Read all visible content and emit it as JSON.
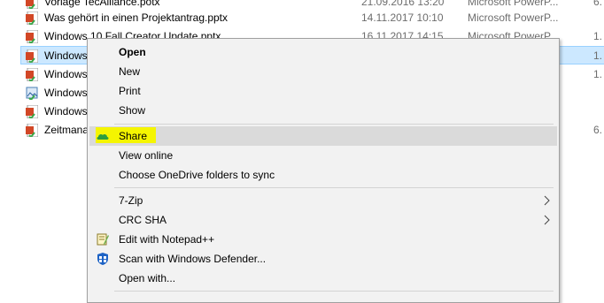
{
  "files": [
    {
      "name": "Vorlage TecAlliance.potx",
      "date": "21.09.2016 13:20",
      "type": "Microsoft PowerP...",
      "size": "6."
    },
    {
      "name": "Was gehört in einen Projektantrag.pptx",
      "date": "14.11.2017 10:10",
      "type": "Microsoft PowerP...",
      "size": ""
    },
    {
      "name": "Windows 10 Fall Creator Update.pptx",
      "date": "16.11.2017 14:15",
      "type": "Microsoft PowerP...",
      "size": "1."
    },
    {
      "name": "Windows",
      "date": "",
      "type": "",
      "size": "1."
    },
    {
      "name": "Windows",
      "date": "",
      "type": "",
      "size": "1."
    },
    {
      "name": "Windows",
      "date": "",
      "type": "",
      "size": ""
    },
    {
      "name": "Windows",
      "date": "",
      "type": "",
      "size": ""
    },
    {
      "name": "Zeitmana",
      "date": "",
      "type": "",
      "size": "6."
    }
  ],
  "context_menu": {
    "open": "Open",
    "new": "New",
    "print": "Print",
    "show": "Show",
    "share": "Share",
    "view_online": "View online",
    "choose_folders": "Choose OneDrive folders to sync",
    "seven_zip": "7-Zip",
    "crc_sha": "CRC SHA",
    "edit_notepad": "Edit with Notepad++",
    "scan_defender": "Scan with Windows Defender...",
    "open_with": "Open with..."
  },
  "colors": {
    "share_highlight": "#f5f500",
    "selection": "#cce8ff",
    "menu_bg": "#f2f2f2",
    "onedrive_green": "#2e9e3e"
  }
}
